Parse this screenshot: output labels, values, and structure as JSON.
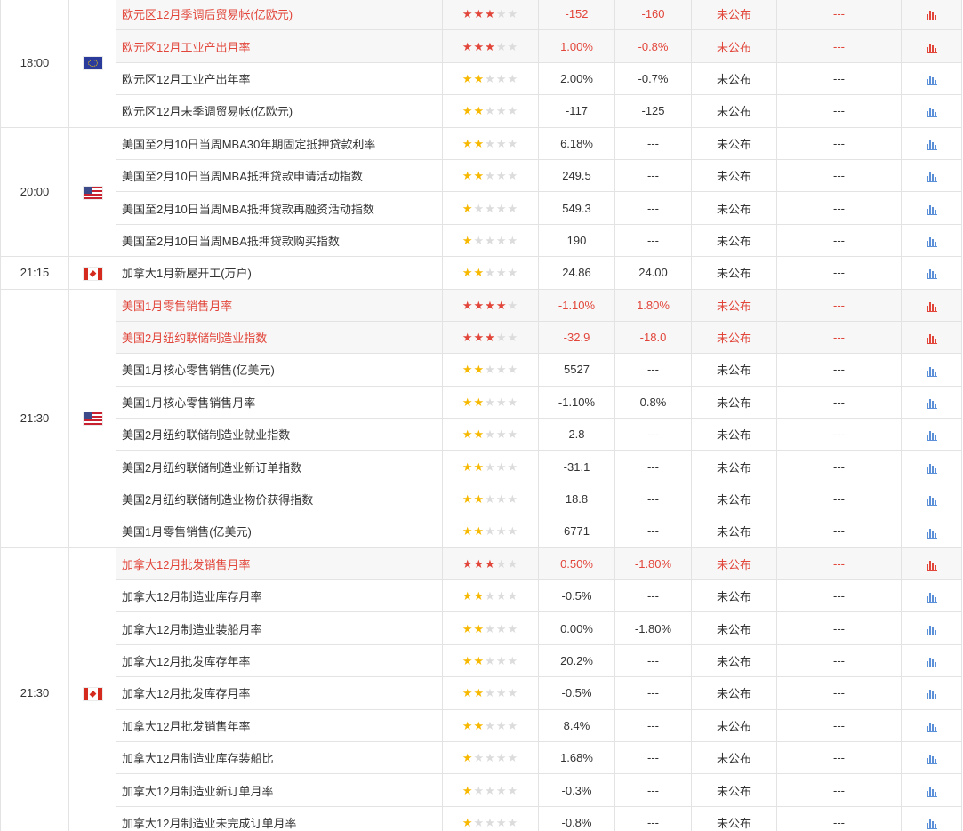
{
  "colors": {
    "highlight_text": "#e2463b",
    "highlight_bg": "#f7f7f7",
    "star_yellow": "#f7b800",
    "star_red": "#e2463b",
    "star_off": "#dcdcdc",
    "chart_blue": "#5b8fd8",
    "border": "#e3e3e3"
  },
  "groups": [
    {
      "time": "18:00",
      "flag": "flag-eu",
      "rows": [
        {
          "name": "欧元区12月季调后贸易帐(亿欧元)",
          "stars": 3,
          "previous": "-152",
          "forecast": "-160",
          "actual": "未公布",
          "impact": "---",
          "highlight": true
        },
        {
          "name": "欧元区12月工业产出月率",
          "stars": 3,
          "previous": "1.00%",
          "forecast": "-0.8%",
          "actual": "未公布",
          "impact": "---",
          "highlight": true
        },
        {
          "name": "欧元区12月工业产出年率",
          "stars": 2,
          "previous": "2.00%",
          "forecast": "-0.7%",
          "actual": "未公布",
          "impact": "---",
          "highlight": false
        },
        {
          "name": "欧元区12月未季调贸易帐(亿欧元)",
          "stars": 2,
          "previous": "-117",
          "forecast": "-125",
          "actual": "未公布",
          "impact": "---",
          "highlight": false
        }
      ]
    },
    {
      "time": "20:00",
      "flag": "flag-us",
      "rows": [
        {
          "name": "美国至2月10日当周MBA30年期固定抵押贷款利率",
          "stars": 2,
          "previous": "6.18%",
          "forecast": "---",
          "actual": "未公布",
          "impact": "---",
          "highlight": false
        },
        {
          "name": "美国至2月10日当周MBA抵押贷款申请活动指数",
          "stars": 2,
          "previous": "249.5",
          "forecast": "---",
          "actual": "未公布",
          "impact": "---",
          "highlight": false
        },
        {
          "name": "美国至2月10日当周MBA抵押贷款再融资活动指数",
          "stars": 1,
          "previous": "549.3",
          "forecast": "---",
          "actual": "未公布",
          "impact": "---",
          "highlight": false
        },
        {
          "name": "美国至2月10日当周MBA抵押贷款购买指数",
          "stars": 1,
          "previous": "190",
          "forecast": "---",
          "actual": "未公布",
          "impact": "---",
          "highlight": false
        }
      ]
    },
    {
      "time": "21:15",
      "flag": "flag-ca",
      "rows": [
        {
          "name": "加拿大1月新屋开工(万户)",
          "stars": 2,
          "previous": "24.86",
          "forecast": "24.00",
          "actual": "未公布",
          "impact": "---",
          "highlight": false
        }
      ]
    },
    {
      "time": "21:30",
      "flag": "flag-us",
      "rows": [
        {
          "name": "美国1月零售销售月率",
          "stars": 4,
          "previous": "-1.10%",
          "forecast": "1.80%",
          "actual": "未公布",
          "impact": "---",
          "highlight": true
        },
        {
          "name": "美国2月纽约联储制造业指数",
          "stars": 3,
          "previous": "-32.9",
          "forecast": "-18.0",
          "actual": "未公布",
          "impact": "---",
          "highlight": true
        },
        {
          "name": "美国1月核心零售销售(亿美元)",
          "stars": 2,
          "previous": "5527",
          "forecast": "---",
          "actual": "未公布",
          "impact": "---",
          "highlight": false
        },
        {
          "name": "美国1月核心零售销售月率",
          "stars": 2,
          "previous": "-1.10%",
          "forecast": "0.8%",
          "actual": "未公布",
          "impact": "---",
          "highlight": false
        },
        {
          "name": "美国2月纽约联储制造业就业指数",
          "stars": 2,
          "previous": "2.8",
          "forecast": "---",
          "actual": "未公布",
          "impact": "---",
          "highlight": false
        },
        {
          "name": "美国2月纽约联储制造业新订单指数",
          "stars": 2,
          "previous": "-31.1",
          "forecast": "---",
          "actual": "未公布",
          "impact": "---",
          "highlight": false
        },
        {
          "name": "美国2月纽约联储制造业物价获得指数",
          "stars": 2,
          "previous": "18.8",
          "forecast": "---",
          "actual": "未公布",
          "impact": "---",
          "highlight": false
        },
        {
          "name": "美国1月零售销售(亿美元)",
          "stars": 2,
          "previous": "6771",
          "forecast": "---",
          "actual": "未公布",
          "impact": "---",
          "highlight": false
        }
      ]
    },
    {
      "time": "21:30",
      "flag": "flag-ca",
      "rows": [
        {
          "name": "加拿大12月批发销售月率",
          "stars": 3,
          "previous": "0.50%",
          "forecast": "-1.80%",
          "actual": "未公布",
          "impact": "---",
          "highlight": true
        },
        {
          "name": "加拿大12月制造业库存月率",
          "stars": 2,
          "previous": "-0.5%",
          "forecast": "---",
          "actual": "未公布",
          "impact": "---",
          "highlight": false
        },
        {
          "name": "加拿大12月制造业装船月率",
          "stars": 2,
          "previous": "0.00%",
          "forecast": "-1.80%",
          "actual": "未公布",
          "impact": "---",
          "highlight": false
        },
        {
          "name": "加拿大12月批发库存年率",
          "stars": 2,
          "previous": "20.2%",
          "forecast": "---",
          "actual": "未公布",
          "impact": "---",
          "highlight": false
        },
        {
          "name": "加拿大12月批发库存月率",
          "stars": 2,
          "previous": "-0.5%",
          "forecast": "---",
          "actual": "未公布",
          "impact": "---",
          "highlight": false
        },
        {
          "name": "加拿大12月批发销售年率",
          "stars": 2,
          "previous": "8.4%",
          "forecast": "---",
          "actual": "未公布",
          "impact": "---",
          "highlight": false
        },
        {
          "name": "加拿大12月制造业库存装船比",
          "stars": 1,
          "previous": "1.68%",
          "forecast": "---",
          "actual": "未公布",
          "impact": "---",
          "highlight": false
        },
        {
          "name": "加拿大12月制造业新订单月率",
          "stars": 1,
          "previous": "-0.3%",
          "forecast": "---",
          "actual": "未公布",
          "impact": "---",
          "highlight": false
        },
        {
          "name": "加拿大12月制造业未完成订单月率",
          "stars": 1,
          "previous": "-0.8%",
          "forecast": "---",
          "actual": "未公布",
          "impact": "---",
          "highlight": false
        }
      ]
    }
  ]
}
